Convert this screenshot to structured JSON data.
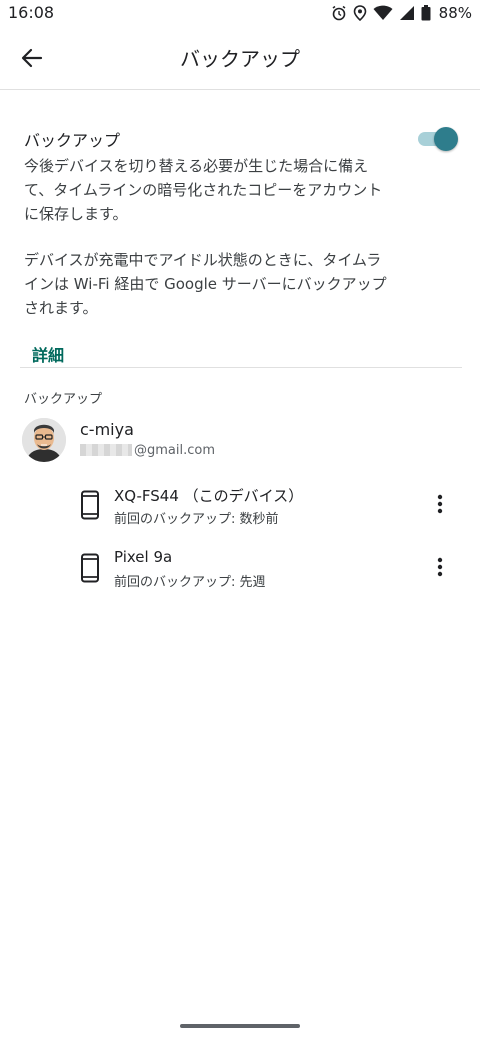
{
  "status_bar": {
    "time": "16:08",
    "battery": "88%",
    "icons": [
      "alarm-icon",
      "location-icon",
      "wifi-icon",
      "signal-icon",
      "battery-icon"
    ]
  },
  "app_bar": {
    "title": "バックアップ",
    "back_icon": "arrow-left-icon"
  },
  "backup_setting": {
    "title": "バックアップ",
    "description": "今後デバイスを切り替える必要が生じた場合に備えて、タイムラインの暗号化されたコピーをアカウントに保存します。",
    "description2": "デバイスが充電中でアイドル状態のときに、タイムラインは Wi-Fi 経由で Google サーバーにバックアップされます。",
    "details_link": "詳細",
    "enabled": true,
    "accent_color": "#2e7d8c"
  },
  "account_section": {
    "label": "バックアップ",
    "account_name": "c-miya",
    "email_visible_part": "@gmail.com"
  },
  "devices": [
    {
      "name": "XQ-FS44 （このデバイス）",
      "last_backup": "前回のバックアップ: 数秒前"
    },
    {
      "name": "Pixel 9a",
      "last_backup": "前回のバックアップ: 先週"
    }
  ],
  "colors": {
    "link": "#00695c",
    "toggle_track": "#a8d0d8",
    "toggle_thumb": "#2e7d8c"
  }
}
